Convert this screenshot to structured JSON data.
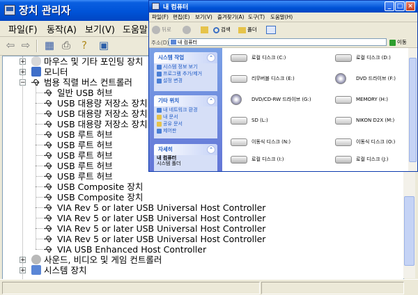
{
  "device_manager": {
    "title": "장치 관리자",
    "menu": [
      "파일(F)",
      "동작(A)",
      "보기(V)",
      "도움말"
    ],
    "tree": [
      {
        "label": "마우스 및 기타 포인팅 장치",
        "level": "category",
        "expanded": false
      },
      {
        "label": "모니터",
        "level": "category",
        "expanded": false
      },
      {
        "label": "범용 직렬 버스 컨트롤러",
        "level": "category",
        "expanded": true
      },
      {
        "label": "일반 USB 허브",
        "level": "child"
      },
      {
        "label": "USB 대용량 저장소 장치",
        "level": "child"
      },
      {
        "label": "USB 대용량 저장소 장치",
        "level": "child"
      },
      {
        "label": "USB 대용량 저장소 장치",
        "level": "child"
      },
      {
        "label": "USB 루트 허브",
        "level": "child"
      },
      {
        "label": "USB 루트 허브",
        "level": "child"
      },
      {
        "label": "USB 루트 허브",
        "level": "child"
      },
      {
        "label": "USB 루트 허브",
        "level": "child"
      },
      {
        "label": "USB 루트 허브",
        "level": "child"
      },
      {
        "label": "USB Composite 장치",
        "level": "child"
      },
      {
        "label": "USB Composite 장치",
        "level": "child"
      },
      {
        "label": "VIA Rev 5 or later USB Universal Host Controller",
        "level": "child"
      },
      {
        "label": "VIA Rev 5 or later USB Universal Host Controller",
        "level": "child"
      },
      {
        "label": "VIA Rev 5 or later USB Universal Host Controller",
        "level": "child"
      },
      {
        "label": "VIA Rev 5 or later USB Universal Host Controller",
        "level": "child"
      },
      {
        "label": "VIA USB Enhanced Host Controller",
        "level": "child"
      },
      {
        "label": "사운드, 비디오 및 게임 컨트롤러",
        "level": "category",
        "expanded": false
      },
      {
        "label": "시스템 장치",
        "level": "category",
        "expanded": false
      }
    ]
  },
  "my_computer": {
    "title": "내 컴퓨터",
    "menu": [
      "파일(F)",
      "편집(E)",
      "보기(V)",
      "즐겨찾기(A)",
      "도구(T)",
      "도움말(H)"
    ],
    "toolbar": {
      "back": "뒤로",
      "search": "검색",
      "folders": "폴더"
    },
    "address_label": "주소(D)",
    "address_value": "내 컴퓨터",
    "go_label": "이동",
    "panels": [
      {
        "title": "시스템 작업",
        "items": [
          "시스템 정보 보기",
          "프로그램 추가/제거",
          "설정 변경"
        ]
      },
      {
        "title": "기타 위치",
        "items": [
          "내 네트워크 환경",
          "내 문서",
          "공유 문서",
          "제어판"
        ]
      },
      {
        "title": "자세히",
        "items": [
          "내 컴퓨터",
          "시스템 폴더"
        ]
      }
    ],
    "drives_left": [
      {
        "label": "로컬 디스크 (C:)",
        "icon": "hdd"
      },
      {
        "label": "리무버블 디스크 (E:)",
        "icon": "removable"
      },
      {
        "label": "DVD/CD-RW 드라이브 (G:)",
        "icon": "dvd"
      },
      {
        "label": "SD (L:)",
        "icon": "removable"
      },
      {
        "label": "이동식 디스크 (N:)",
        "icon": "removable"
      },
      {
        "label": "로컬 디스크 (I:)",
        "icon": "hdd"
      }
    ],
    "drives_right": [
      {
        "label": "로컬 디스크 (D:)",
        "icon": "hdd"
      },
      {
        "label": "DVD 드라이브 (F:)",
        "icon": "dvd"
      },
      {
        "label": "MEMORY (H:)",
        "icon": "removable"
      },
      {
        "label": "NIKON D2X (M:)",
        "icon": "removable"
      },
      {
        "label": "이동식 디스크 (O:)",
        "icon": "removable"
      },
      {
        "label": "로컬 디스크 (J:)",
        "icon": "hdd"
      }
    ]
  }
}
